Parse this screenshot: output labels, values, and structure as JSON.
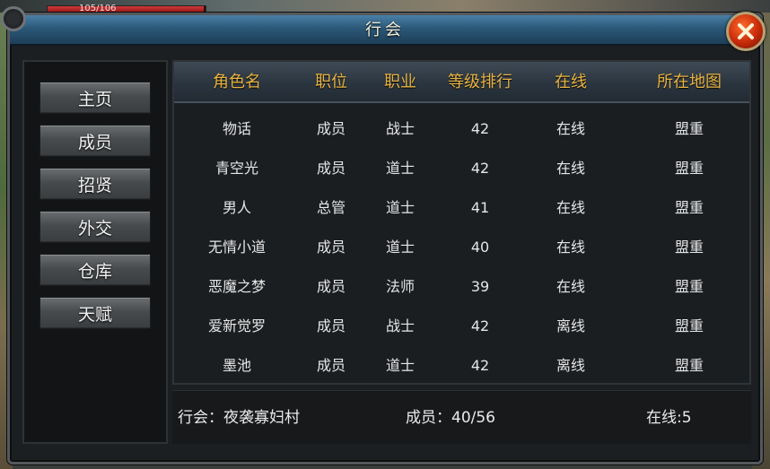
{
  "hud": {
    "hp_text": "105/106",
    "hp_fraction": 0.99
  },
  "window": {
    "title": "行会"
  },
  "sidebar": {
    "items": [
      {
        "label": "主页"
      },
      {
        "label": "成员"
      },
      {
        "label": "招贤"
      },
      {
        "label": "外交"
      },
      {
        "label": "仓库"
      },
      {
        "label": "天赋"
      }
    ]
  },
  "table": {
    "headers": [
      "角色名",
      "职位",
      "职业",
      "等级排行",
      "在线",
      "所在地图"
    ],
    "rows": [
      [
        "物话",
        "成员",
        "战士",
        "42",
        "在线",
        "盟重"
      ],
      [
        "青空光",
        "成员",
        "道士",
        "42",
        "在线",
        "盟重"
      ],
      [
        "男人",
        "总管",
        "道士",
        "41",
        "在线",
        "盟重"
      ],
      [
        "无情小道",
        "成员",
        "道士",
        "40",
        "在线",
        "盟重"
      ],
      [
        "恶魔之梦",
        "成员",
        "法师",
        "39",
        "在线",
        "盟重"
      ],
      [
        "爱新觉罗",
        "成员",
        "战士",
        "42",
        "离线",
        "盟重"
      ],
      [
        "墨池",
        "成员",
        "道士",
        "42",
        "离线",
        "盟重"
      ]
    ]
  },
  "footer": {
    "guild": "行会：夜袭寡妇村",
    "members": "成员：40/56",
    "online": "在线:5"
  },
  "colors": {
    "header_text": "#e8b340",
    "close_button": "#c62a0a",
    "title_bar": "#2b5878"
  }
}
